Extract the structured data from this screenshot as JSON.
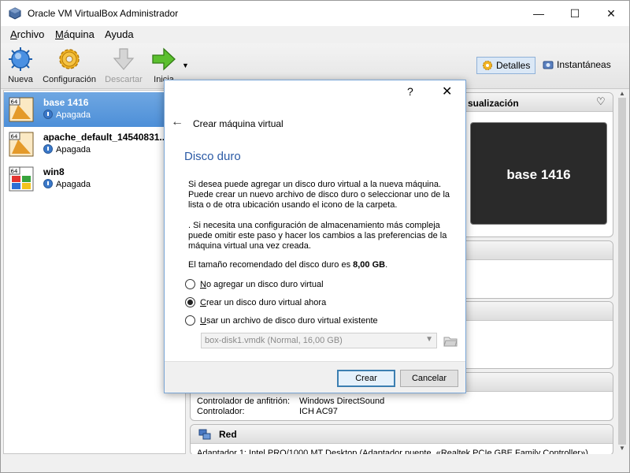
{
  "window": {
    "title": "Oracle VM VirtualBox Administrador",
    "min": "—",
    "max": "☐",
    "close": "✕"
  },
  "menu": [
    {
      "u": "A",
      "rest": "rchivo"
    },
    {
      "u": "M",
      "rest": "áquina"
    },
    {
      "u": "",
      "rest": "Ayuda"
    }
  ],
  "toolbar": {
    "nueva": "Nueva",
    "config": "Configuración",
    "descartar": "Descartar",
    "iniciar": "Inicia",
    "detalles": "Detalles",
    "instantaneas": "Instantáneas"
  },
  "vms": [
    {
      "name": "base 1416",
      "state": "Apagada",
      "badge": "64"
    },
    {
      "name": "apache_default_14540831...",
      "state": "Apagada",
      "badge": "64"
    },
    {
      "name": "win8",
      "state": "Apagada",
      "badge": "64"
    }
  ],
  "details": {
    "preview_header": "sualización",
    "preview_label": "base 1416",
    "audio_rows": [
      {
        "k": "Controlador de anfitrión:",
        "v": "Windows DirectSound"
      },
      {
        "k": "Controlador:",
        "v": "ICH AC97"
      }
    ],
    "red_header": "Red",
    "red_row": "Adaptador 1:   Intel PRO/1000 MT Desktop (Adaptador puente, «Realtek PCIe GBE Family Controller»)"
  },
  "dialog": {
    "help": "?",
    "close": "✕",
    "back": "←",
    "wizard_title": "Crear máquina virtual",
    "page_title": "Disco duro",
    "para1": "Si desea puede agregar un disco duro virtual a la nueva máquina. Puede crear un nuevo archivo de disco duro o seleccionar uno de la lista o de otra ubicación usando el icono de la carpeta.",
    "para2": ". Si necesita una configuración de almacenamiento más compleja puede omitir este paso y hacer los cambios a las preferencias de la máquina virtual una vez creada.",
    "recommended_prefix": "El tamaño recomendado del disco duro es ",
    "recommended_value": "8,00 GB",
    "recommended_suffix": ".",
    "options": [
      {
        "u": "N",
        "rest": "o agregar un disco duro virtual",
        "checked": false
      },
      {
        "u": "C",
        "rest": "rear un disco duro virtual ahora",
        "checked": true
      },
      {
        "u": "U",
        "rest": "sar un archivo de disco duro virtual existente",
        "checked": false
      }
    ],
    "combo_value": "box-disk1.vmdk (Normal, 16,00 GB)",
    "btn_create": "Crear",
    "btn_cancel": "Cancelar"
  }
}
